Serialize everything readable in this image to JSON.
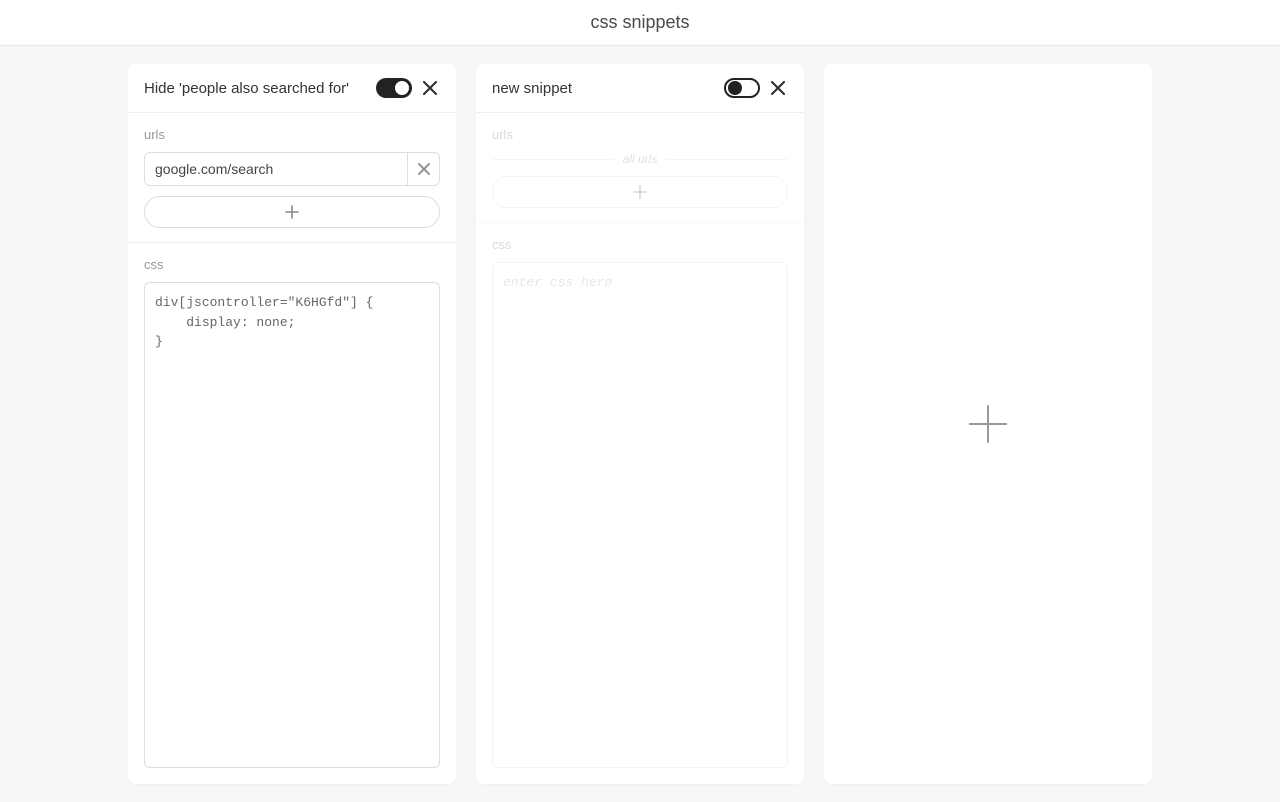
{
  "header": {
    "title": "css snippets"
  },
  "labels": {
    "urls": "urls",
    "css": "css",
    "all_urls": "all urls",
    "css_placeholder": "enter css here"
  },
  "snippets": [
    {
      "title": "Hide 'people also searched for'",
      "active": true,
      "urls": [
        "google.com/search"
      ],
      "css": "div[jscontroller=\"K6HGfd\"] {\n    display: none;\n}"
    },
    {
      "title": "new snippet",
      "active": false,
      "urls": [],
      "css": ""
    }
  ]
}
